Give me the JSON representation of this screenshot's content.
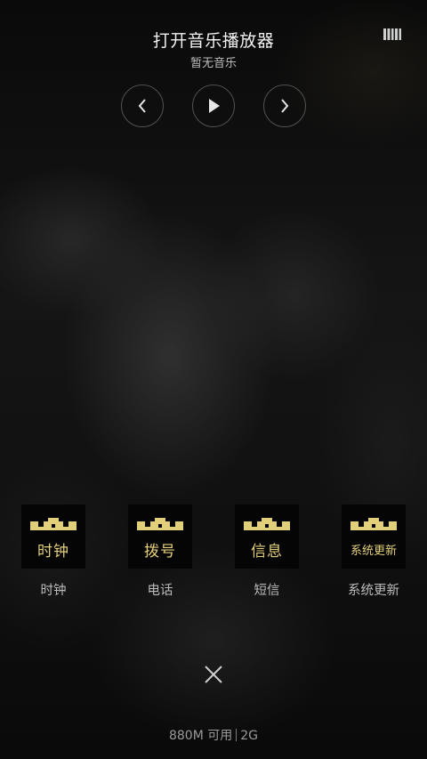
{
  "music": {
    "title": "打开音乐播放器",
    "subtitle": "暂无音乐",
    "icon": "sound-bars-icon",
    "controls": [
      "previous-icon",
      "play-icon",
      "next-icon"
    ]
  },
  "apps": [
    {
      "label": "时钟",
      "icon_text": "时钟"
    },
    {
      "label": "电话",
      "icon_text": "拨号"
    },
    {
      "label": "短信",
      "icon_text": "信息"
    },
    {
      "label": "系统更新",
      "icon_text": "系统更新"
    }
  ],
  "close": {
    "icon": "close-icon"
  },
  "memory": {
    "available": "880M 可用",
    "total": "2G"
  },
  "colors": {
    "icon_gold": "#e2cf7a",
    "icon_bg": "#050505",
    "text_primary": "#f2f2f2",
    "text_secondary": "#bcbcbc"
  }
}
